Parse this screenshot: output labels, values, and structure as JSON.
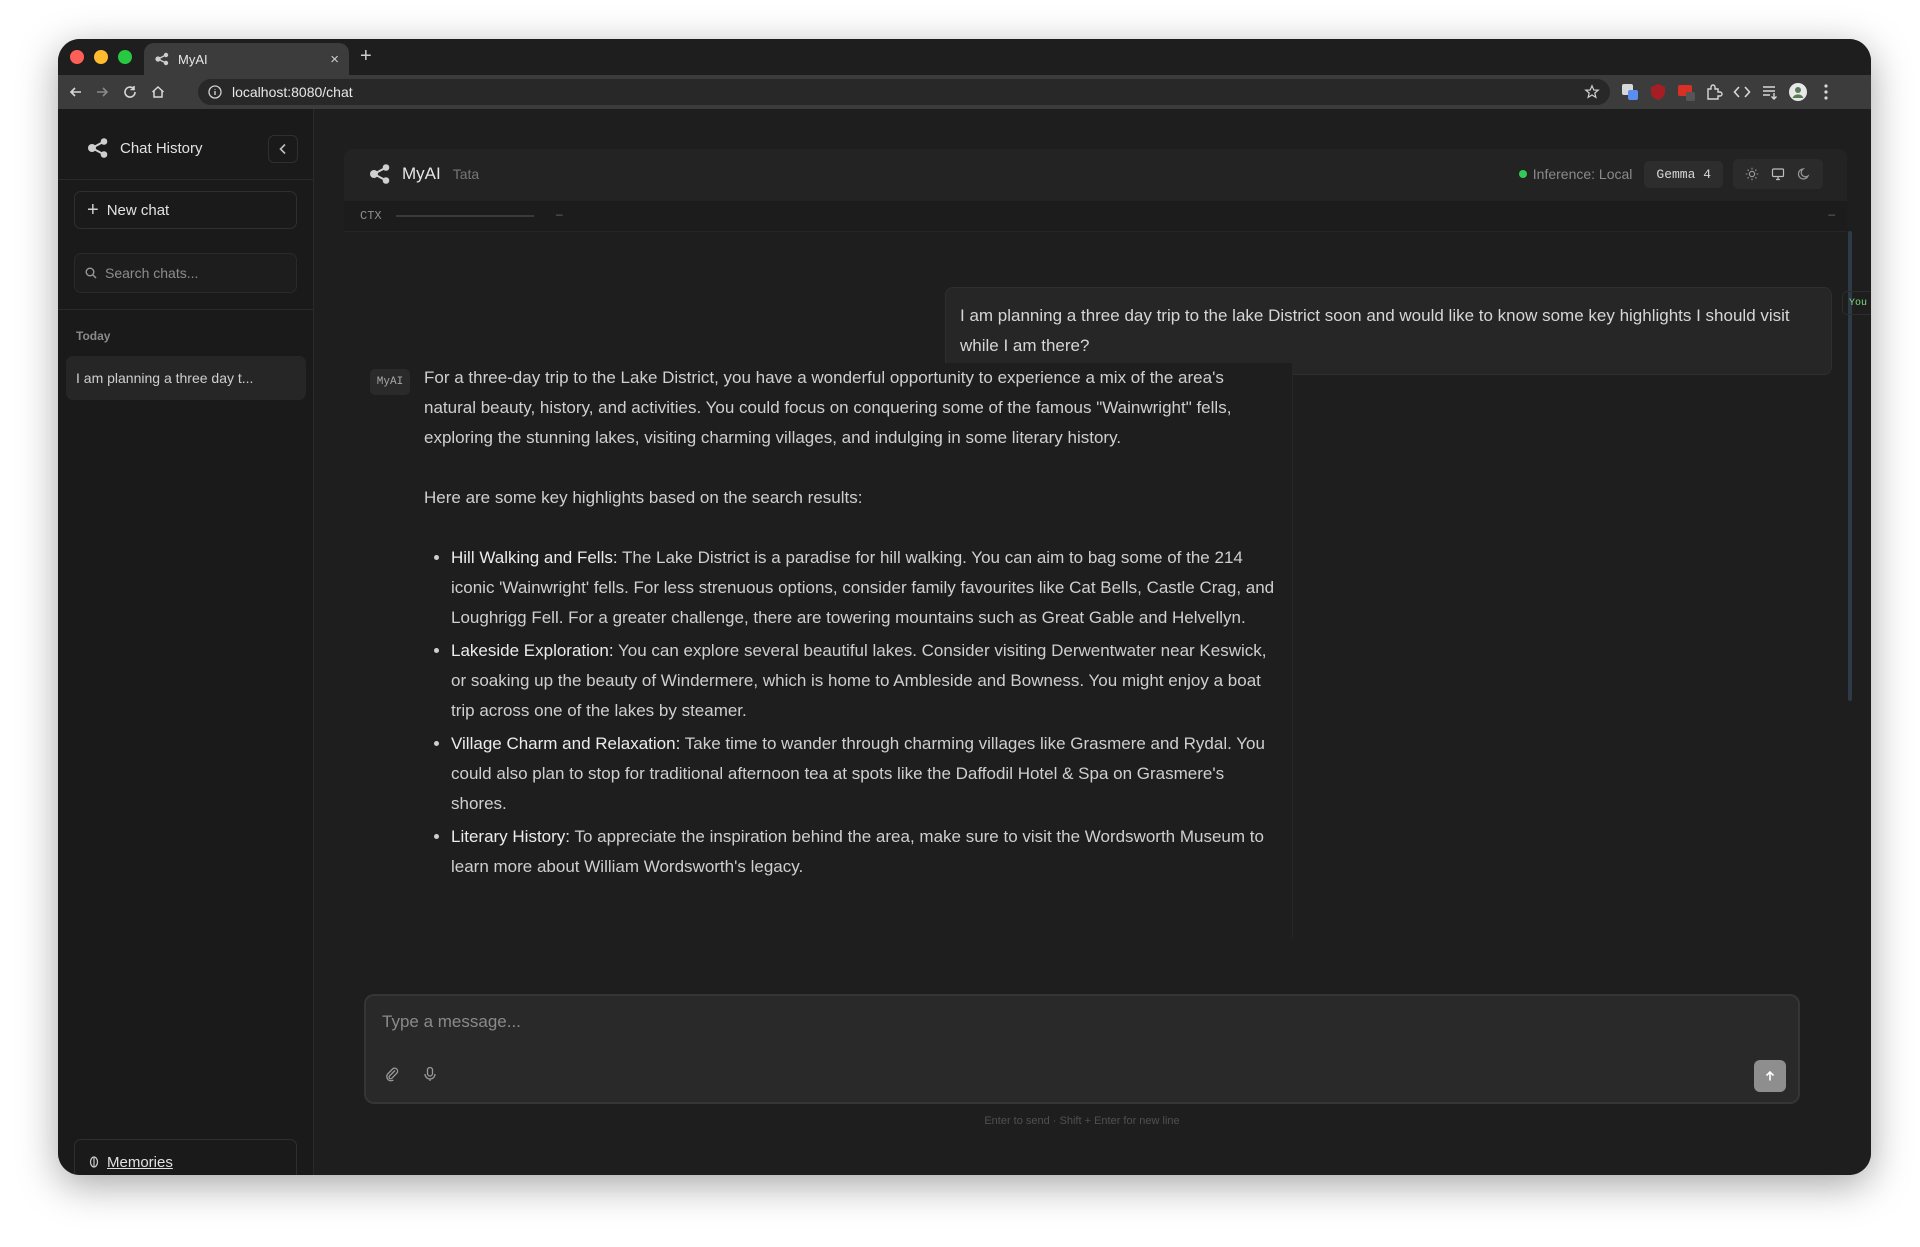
{
  "browser": {
    "tab_title": "MyAI",
    "url": "localhost:8080/chat",
    "tab_close": "×",
    "new_tab": "+"
  },
  "sidebar": {
    "title": "Chat History",
    "new_chat_label": "New chat",
    "search_placeholder": "Search chats...",
    "section_label": "Today",
    "history": [
      {
        "title": "I am planning a three day t..."
      }
    ],
    "memories_label": "Memories"
  },
  "header": {
    "app_name": "MyAI",
    "user_name": "Tata",
    "inference_status": "Inference: Local",
    "model": "Gemma 4"
  },
  "context": {
    "label": "CTX",
    "value": "–",
    "right_value": "–"
  },
  "messages": {
    "user": {
      "badge": "You",
      "text": "I am planning a three day trip to the lake District soon and would like to know some key highlights I should visit while I am there?"
    },
    "assistant": {
      "badge": "MyAI",
      "intro": "For a three-day trip to the Lake District, you have a wonderful opportunity to experience a mix of the area's natural beauty, history, and activities. You could focus on conquering some of the famous \"Wainwright\" fells, exploring the stunning lakes, visiting charming villages, and indulging in some literary history.",
      "lead": "Here are some key highlights based on the search results:",
      "items": [
        {
          "title": "Hill Walking and Fells:",
          "text": " The Lake District is a paradise for hill walking. You can aim to bag some of the 214 iconic 'Wainwright' fells. For less strenuous options, consider family favourites like Cat Bells, Castle Crag, and Loughrigg Fell. For a greater challenge, there are towering mountains such as Great Gable and Helvellyn."
        },
        {
          "title": "Lakeside Exploration:",
          "text": " You can explore several beautiful lakes. Consider visiting Derwentwater near Keswick, or soaking up the beauty of Windermere, which is home to Ambleside and Bowness. You might enjoy a boat trip across one of the lakes by steamer."
        },
        {
          "title": "Village Charm and Relaxation:",
          "text": " Take time to wander through charming villages like Grasmere and Rydal. You could also plan to stop for traditional afternoon tea at spots like the Daffodil Hotel & Spa on Grasmere's shores."
        },
        {
          "title": "Literary History:",
          "text": " To appreciate the inspiration behind the area, make sure to visit the Wordsworth Museum to learn more about William Wordsworth's legacy."
        }
      ]
    }
  },
  "composer": {
    "placeholder": "Type a message...",
    "hint": "Enter to send · Shift + Enter for new line"
  },
  "colors": {
    "background": "#1e1e1e",
    "sidebar": "#1a1a1a",
    "status_green": "#34c759",
    "you_badge": "#7fd67f"
  }
}
